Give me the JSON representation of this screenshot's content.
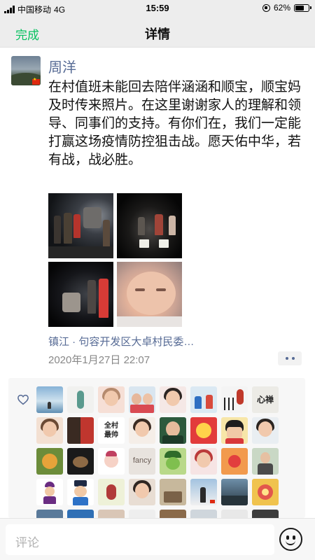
{
  "status_bar": {
    "carrier": "中国移动",
    "network": "4G",
    "time": "15:59",
    "battery": "62%"
  },
  "nav": {
    "done_label": "完成",
    "title": "详情"
  },
  "post": {
    "author": "周洋",
    "text": "在村值班未能回去陪伴涵涵和顺宝，顺宝妈及时传来照片。在这里谢谢家人的理解和领导、同事们的支持。有你们在，我们一定能打赢这场疫情防控狙击战。愿天佑中华，若有战，战必胜。",
    "location": "镇江 · 句容开发区大卓村民委…",
    "time": "2020年1月27日 22:07"
  },
  "likes": {
    "heart_icon": "heart-outline-icon",
    "avatar_texts": {
      "calligraphy": "心禅",
      "slogan": "全村最帅",
      "fancy": "fancy"
    }
  },
  "comment": {
    "placeholder": "评论",
    "emoji_icon": "smiley-icon"
  },
  "colors": {
    "accent_green": "#07c160",
    "link_blue": "#576b95",
    "meta_gray": "#888888"
  }
}
